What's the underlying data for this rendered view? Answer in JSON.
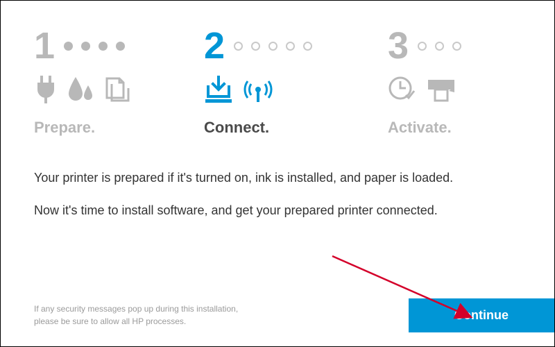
{
  "stepper": {
    "steps": [
      {
        "num": "1",
        "label": "Prepare.",
        "active": false,
        "icons": [
          "plug-icon",
          "ink-drops-icon",
          "paper-copy-icon"
        ]
      },
      {
        "num": "2",
        "label": "Connect.",
        "active": true,
        "icons": [
          "install-icon",
          "wireless-icon"
        ]
      },
      {
        "num": "3",
        "label": "Activate.",
        "active": false,
        "icons": [
          "clock-check-icon",
          "print-icon"
        ]
      }
    ],
    "dots_between_1_2": 4,
    "dots_between_2_3": 5,
    "dots_after_3": 3
  },
  "body": {
    "line1": "Your printer is prepared if it's turned on, ink is installed, and paper is loaded.",
    "line2": "Now it's time to install software, and get your prepared printer connected."
  },
  "footer": {
    "note_line1": "If any security messages pop up during this installation,",
    "note_line2": "please be sure to allow all HP processes.",
    "continue_label": "Continue"
  },
  "colors": {
    "brand": "#0096d6",
    "inactive": "#b8b8b8",
    "text": "#333333",
    "annotation": "#d4002a"
  }
}
